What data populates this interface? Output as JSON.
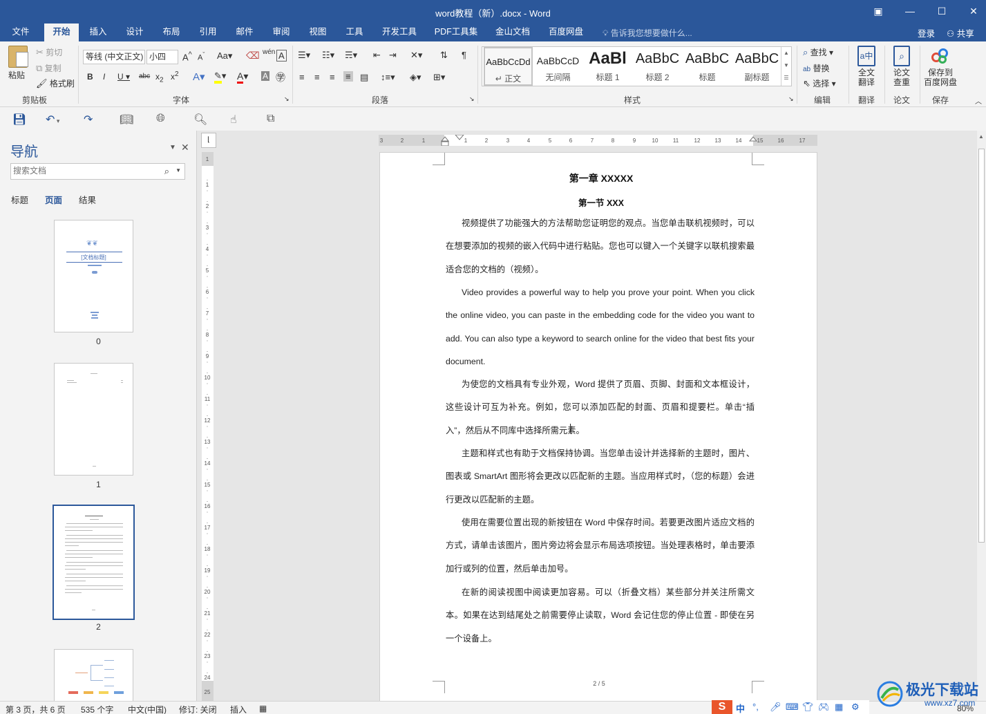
{
  "window": {
    "title": "word教程（新）.docx - Word",
    "controls": {
      "restore": "▣",
      "minimize": "—",
      "maximize": "☐",
      "close": "✕"
    }
  },
  "ribbon_tabs": [
    "文件",
    "开始",
    "插入",
    "设计",
    "布局",
    "引用",
    "邮件",
    "审阅",
    "视图",
    "工具",
    "开发工具",
    "PDF工具集",
    "金山文档",
    "百度网盘"
  ],
  "active_tab": "开始",
  "tell_me": "告诉我您想要做什么...",
  "account": {
    "login": "登录",
    "share": "共享"
  },
  "clipboard": {
    "paste": "粘贴",
    "cut": "剪切",
    "copy": "复制",
    "format_painter": "格式刷",
    "label": "剪贴板"
  },
  "font": {
    "name": "等线 (中文正文)",
    "size": "小四",
    "label": "字体"
  },
  "paragraph": {
    "label": "段落"
  },
  "styles": {
    "label": "样式",
    "items": [
      {
        "sample": "AaBbCcDd",
        "name": "↵ 正文"
      },
      {
        "sample": "AaBbCcD",
        "name": "无间隔"
      },
      {
        "sample": "AaBl",
        "name": "标题 1"
      },
      {
        "sample": "AaBbC",
        "name": "标题 2"
      },
      {
        "sample": "AaBbC",
        "name": "标题"
      },
      {
        "sample": "AaBbC",
        "name": "副标题"
      }
    ]
  },
  "editing": {
    "find": "查找",
    "replace": "替换",
    "select": "选择",
    "label": "编辑"
  },
  "translate": {
    "button": "全文\n翻译",
    "label": "翻译"
  },
  "paper": {
    "button": "论文\n查重",
    "label": "论文"
  },
  "save": {
    "button": "保存到\n百度网盘",
    "label": "保存"
  },
  "nav": {
    "title": "导航",
    "search_placeholder": "搜索文档",
    "tabs": [
      "标题",
      "页面",
      "结果"
    ],
    "active_tab": "页面",
    "pages": [
      "0",
      "1",
      "2"
    ],
    "selected_page": "2",
    "cover_title": "[文档标题]"
  },
  "document": {
    "heading1": "第一章 XXXXX",
    "heading2": "第一节 XXX",
    "paragraphs": [
      "视频提供了功能强大的方法帮助您证明您的观点。当您单击联机视频时，可以在想要添加的视频的嵌入代码中进行粘贴。您也可以键入一个关键字以联机搜索最适合您的文档的（视频）。",
      "Video provides a powerful way to help you prove your point. When you click the online video, you can paste in the embedding code for the video you want to add. You can also type a keyword to search online for the video that best fits your document.",
      "为使您的文档具有专业外观，Word 提供了页眉、页脚、封面和文本框设计，这些设计可互为补充。例如，您可以添加匹配的封面、页眉和提要栏。单击“插入”，然后从不同库中选择所需元素。",
      "主题和样式也有助于文档保持协调。当您单击设计并选择新的主题时，图片、图表或 SmartArt 图形将会更改以匹配新的主题。当应用样式时，（您的标题）会进行更改以匹配新的主题。",
      "使用在需要位置出现的新按钮在 Word 中保存时间。若要更改图片适应文档的方式，请单击该图片，图片旁边将会显示布局选项按钮。当处理表格时，单击要添加行或列的位置，然后单击加号。",
      "在新的阅读视图中阅读更加容易。可以（折叠文档）某些部分并关注所需文本。如果在达到结尾处之前需要停止读取，Word 会记住您的停止位置 - 即使在另一个设备上。"
    ],
    "page_number": "2 / 5"
  },
  "status": {
    "page": "第 3 页，共 6 页",
    "words": "535 个字",
    "language": "中文(中国)",
    "track_changes": "修订: 关闭",
    "mode": "插入",
    "zoom": "80%"
  },
  "ime": {
    "lang": "中"
  },
  "watermark": {
    "name": "极光下载站",
    "url": "www.xz7.com"
  },
  "colors": {
    "accent": "#2b579a",
    "ribbon_bg": "#f3f3f3",
    "canvas": "#e6e6e6"
  }
}
